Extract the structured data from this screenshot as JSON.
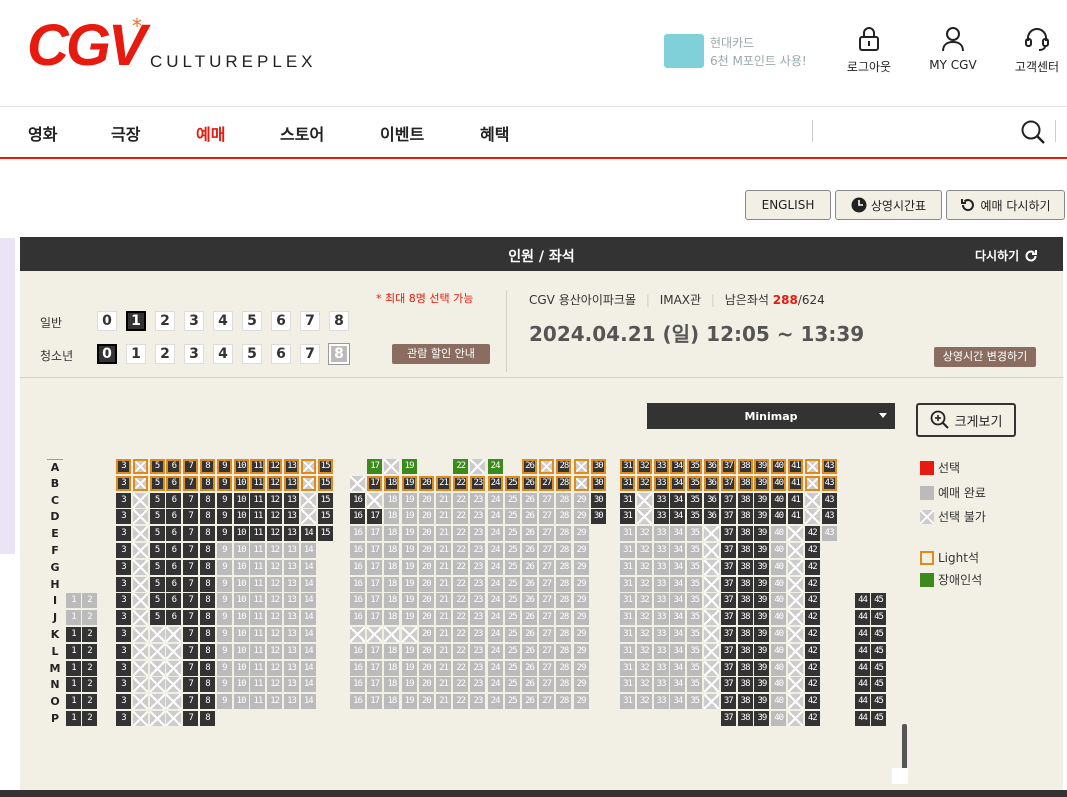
{
  "header": {
    "logo": "CGV",
    "logo_star": "*",
    "logo_sub": "CULTUREPLEX",
    "card_ad": {
      "line1": "현대카드",
      "line2": "6천 M포인트 사용!"
    },
    "icons": [
      {
        "name": "lock-icon",
        "label": "로그아웃"
      },
      {
        "name": "user-icon",
        "label": "MY CGV"
      },
      {
        "name": "headset-icon",
        "label": "고객센터"
      }
    ]
  },
  "nav": {
    "items": [
      "영화",
      "극장",
      "예매",
      "스토어",
      "이벤트",
      "혜택"
    ],
    "active": "예매"
  },
  "top_buttons": {
    "english": "ENGLISH",
    "schedule": "상영시간표",
    "rebook": "예매 다시하기"
  },
  "panel": {
    "title": "인원 / 좌석",
    "reset": "다시하기",
    "max_note": "* 최대 8명 선택 가능",
    "people": [
      {
        "label": "일반",
        "options": [
          "0",
          "1",
          "2",
          "3",
          "4",
          "5",
          "6",
          "7",
          "8"
        ],
        "selected": "1"
      },
      {
        "label": "청소년",
        "options": [
          "0",
          "1",
          "2",
          "3",
          "4",
          "5",
          "6",
          "7",
          "8"
        ],
        "selected": "0",
        "disabled": "8"
      }
    ],
    "discount_button": "관람 할인 안내",
    "theater": {
      "cinema": "CGV 용산아이파크몰",
      "hall": "IMAX관",
      "remaining_label": "남은좌석",
      "remaining": "288",
      "total": "/624"
    },
    "date": "2024.04.21",
    "weekday": "(일)",
    "time": "12:05 ~ 13:39",
    "change_time_button": "상영시간 변경하기"
  },
  "seat_map": {
    "minimap_label": "Minimap",
    "zoom_label": "크게보기",
    "rows": [
      "A",
      "B",
      "C",
      "D",
      "E",
      "F",
      "G",
      "H",
      "I",
      "J",
      "K",
      "L",
      "M",
      "N",
      "O",
      "P"
    ]
  },
  "legend": [
    {
      "label": "선택",
      "color": "#e71a0f"
    },
    {
      "label": "예매 완료",
      "color": "#bbbbbb"
    },
    {
      "label": "선택 불가",
      "color": "#cccccc"
    },
    {
      "label": "Light석",
      "color": "#e08a1e"
    },
    {
      "label": "장애인석",
      "color": "#3c8a1e"
    }
  ]
}
